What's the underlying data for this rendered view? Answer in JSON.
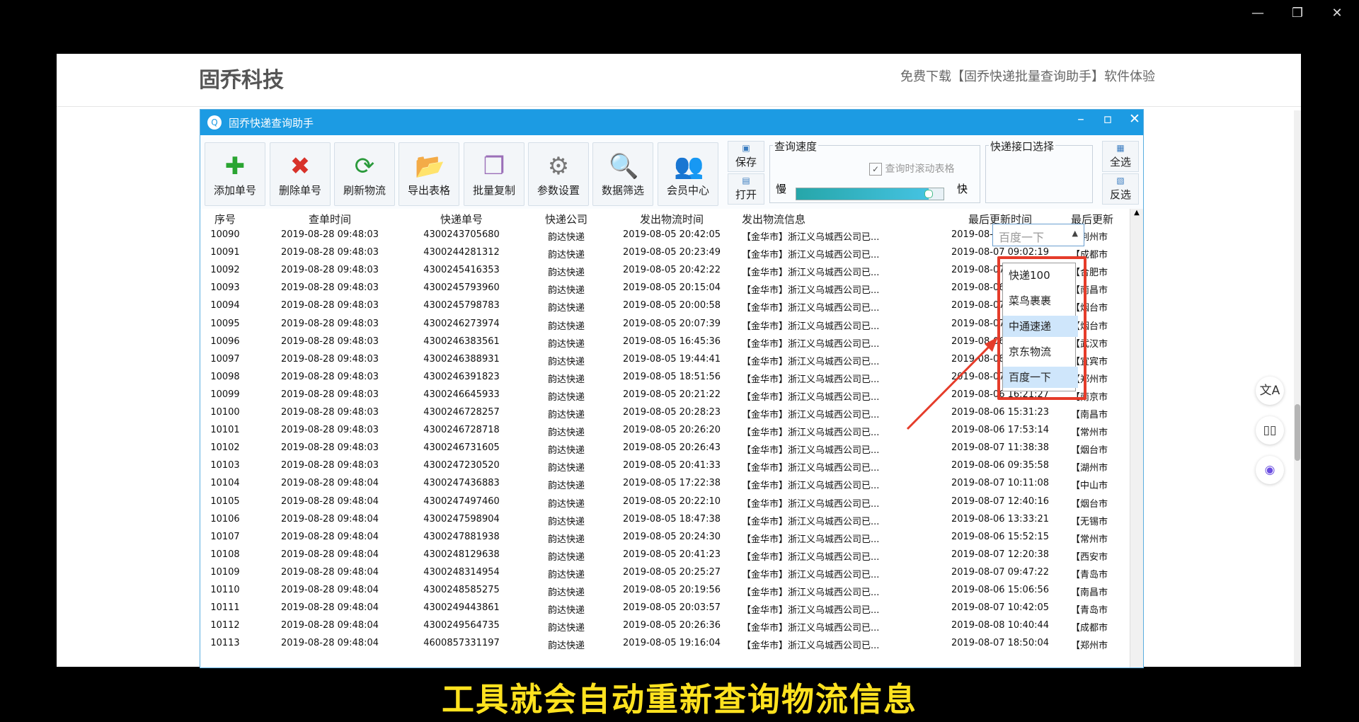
{
  "os_window": {
    "minimize": "—",
    "restore": "❐",
    "close": "✕"
  },
  "site": {
    "brand": "固乔科技",
    "promo": "免费下载【固乔快递批量查询助手】软件体验"
  },
  "side_icons": [
    "translate-icon",
    "reader-icon",
    "assistant-icon"
  ],
  "app": {
    "title": "固乔快递查询助手",
    "toolbar": [
      {
        "label": "添加单号",
        "icon": "add-icon"
      },
      {
        "label": "删除单号",
        "icon": "delete-icon"
      },
      {
        "label": "刷新物流",
        "icon": "refresh-icon"
      },
      {
        "label": "导出表格",
        "icon": "export-icon"
      },
      {
        "label": "批量复制",
        "icon": "copy-icon"
      },
      {
        "label": "参数设置",
        "icon": "settings-icon"
      },
      {
        "label": "数据筛选",
        "icon": "filter-icon"
      },
      {
        "label": "会员中心",
        "icon": "member-icon"
      }
    ],
    "save_label": "保存",
    "open_label": "打开",
    "speed": {
      "group_title": "查询速度",
      "scroll_checkbox": "查询时滚动表格",
      "checked": true,
      "slow": "慢",
      "fast": "快",
      "level": 0.9
    },
    "interface": {
      "group_title": "快递接口选择",
      "selected": "百度一下",
      "options": [
        "快递100",
        "菜鸟裹裹",
        "中通速递",
        "京东物流",
        "百度一下"
      ]
    },
    "select_all": "全选",
    "invert": "反选",
    "columns": [
      "序号",
      "查单时间",
      "快递单号",
      "快递公司",
      "发出物流时间",
      "发出物流信息",
      "最后更新时间",
      "最后更新"
    ],
    "rows": [
      [
        "10090",
        "2019-08-28 09:48:03",
        "4300243705680",
        "韵达快递",
        "2019-08-05 20:42:05",
        "【金华市】浙江义乌城西公司已...",
        "2019-08-07 11:26:41",
        "【荆州市"
      ],
      [
        "10091",
        "2019-08-28 09:48:03",
        "4300244281312",
        "韵达快递",
        "2019-08-05 20:23:49",
        "【金华市】浙江义乌城西公司已...",
        "2019-08-07 09:02:19",
        "【成都市"
      ],
      [
        "10092",
        "2019-08-28 09:48:03",
        "4300245416353",
        "韵达快递",
        "2019-08-05 20:42:22",
        "【金华市】浙江义乌城西公司已...",
        "2019-08-07 15:33:40",
        "【合肥市"
      ],
      [
        "10093",
        "2019-08-28 09:48:03",
        "4300245793960",
        "韵达快递",
        "2019-08-05 20:15:04",
        "【金华市】浙江义乌城西公司已...",
        "2019-08-06 18:14:07",
        "【南昌市"
      ],
      [
        "10094",
        "2019-08-28 09:48:03",
        "4300245798783",
        "韵达快递",
        "2019-08-05 20:00:58",
        "【金华市】浙江义乌城西公司已...",
        "2019-08-07 10:45:12",
        "【烟台市"
      ],
      [
        "10095",
        "2019-08-28 09:48:03",
        "4300246273974",
        "韵达快递",
        "2019-08-05 20:07:39",
        "【金华市】浙江义乌城西公司已...",
        "2019-08-07 12:05:49",
        "【烟台市"
      ],
      [
        "10096",
        "2019-08-28 09:48:03",
        "4300246383561",
        "韵达快递",
        "2019-08-05 16:45:36",
        "【金华市】浙江义乌城西公司已...",
        "2019-08-06 17:37:05",
        "【武汉市"
      ],
      [
        "10097",
        "2019-08-28 09:48:03",
        "4300246388931",
        "韵达快递",
        "2019-08-05 19:44:41",
        "【金华市】浙江义乌城西公司已...",
        "2019-08-08 13:35:57",
        "【宜宾市"
      ],
      [
        "10098",
        "2019-08-28 09:48:03",
        "4300246391823",
        "韵达快递",
        "2019-08-05 18:51:56",
        "【金华市】浙江义乌城西公司已...",
        "2019-08-07 09:50:45",
        "【郑州市"
      ],
      [
        "10099",
        "2019-08-28 09:48:03",
        "4300246645933",
        "韵达快递",
        "2019-08-05 20:21:22",
        "【金华市】浙江义乌城西公司已...",
        "2019-08-06 16:21:27",
        "【南京市"
      ],
      [
        "10100",
        "2019-08-28 09:48:03",
        "4300246728257",
        "韵达快递",
        "2019-08-05 20:28:23",
        "【金华市】浙江义乌城西公司已...",
        "2019-08-06 15:31:23",
        "【南昌市"
      ],
      [
        "10101",
        "2019-08-28 09:48:03",
        "4300246728718",
        "韵达快递",
        "2019-08-05 20:26:20",
        "【金华市】浙江义乌城西公司已...",
        "2019-08-06 17:53:14",
        "【常州市"
      ],
      [
        "10102",
        "2019-08-28 09:48:03",
        "4300246731605",
        "韵达快递",
        "2019-08-05 20:26:43",
        "【金华市】浙江义乌城西公司已...",
        "2019-08-07 11:38:38",
        "【烟台市"
      ],
      [
        "10103",
        "2019-08-28 09:48:03",
        "4300247230520",
        "韵达快递",
        "2019-08-05 20:41:33",
        "【金华市】浙江义乌城西公司已...",
        "2019-08-06 09:35:58",
        "【湖州市"
      ],
      [
        "10104",
        "2019-08-28 09:48:04",
        "4300247436883",
        "韵达快递",
        "2019-08-05 17:22:38",
        "【金华市】浙江义乌城西公司已...",
        "2019-08-07 10:11:08",
        "【中山市"
      ],
      [
        "10105",
        "2019-08-28 09:48:04",
        "4300247497460",
        "韵达快递",
        "2019-08-05 20:22:10",
        "【金华市】浙江义乌城西公司已...",
        "2019-08-07 12:40:16",
        "【烟台市"
      ],
      [
        "10106",
        "2019-08-28 09:48:04",
        "4300247598904",
        "韵达快递",
        "2019-08-05 18:47:38",
        "【金华市】浙江义乌城西公司已...",
        "2019-08-06 13:33:21",
        "【无锡市"
      ],
      [
        "10107",
        "2019-08-28 09:48:04",
        "4300247881938",
        "韵达快递",
        "2019-08-05 20:24:30",
        "【金华市】浙江义乌城西公司已...",
        "2019-08-06 15:52:15",
        "【常州市"
      ],
      [
        "10108",
        "2019-08-28 09:48:04",
        "4300248129638",
        "韵达快递",
        "2019-08-05 20:41:23",
        "【金华市】浙江义乌城西公司已...",
        "2019-08-07 12:20:38",
        "【西安市"
      ],
      [
        "10109",
        "2019-08-28 09:48:04",
        "4300248314954",
        "韵达快递",
        "2019-08-05 20:25:27",
        "【金华市】浙江义乌城西公司已...",
        "2019-08-07 09:47:22",
        "【青岛市"
      ],
      [
        "10110",
        "2019-08-28 09:48:04",
        "4300248585275",
        "韵达快递",
        "2019-08-05 20:19:56",
        "【金华市】浙江义乌城西公司已...",
        "2019-08-06 15:06:56",
        "【南昌市"
      ],
      [
        "10111",
        "2019-08-28 09:48:04",
        "4300249443861",
        "韵达快递",
        "2019-08-05 20:03:57",
        "【金华市】浙江义乌城西公司已...",
        "2019-08-07 10:42:05",
        "【青岛市"
      ],
      [
        "10112",
        "2019-08-28 09:48:04",
        "4300249564735",
        "韵达快递",
        "2019-08-05 20:26:36",
        "【金华市】浙江义乌城西公司已...",
        "2019-08-08 10:40:44",
        "【成都市"
      ],
      [
        "10113",
        "2019-08-28 09:48:04",
        "4600857331197",
        "韵达快递",
        "2019-08-05 19:16:04",
        "【金华市】浙江义乌城西公司已...",
        "2019-08-07 18:50:04",
        "【郑州市"
      ]
    ]
  },
  "subtitle": "工具就会自动重新查询物流信息",
  "colors": {
    "titlebar": "#1c9be3",
    "highlight": "#e53c2a",
    "subtitle": "#ffe21f"
  }
}
